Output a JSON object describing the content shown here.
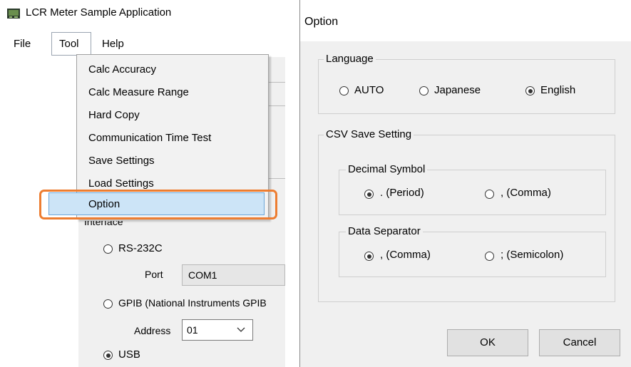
{
  "left": {
    "title": "LCR Meter Sample Application",
    "menu": {
      "file": "File",
      "tool": "Tool",
      "help": "Help"
    },
    "tool_menu": [
      "Calc Accuracy",
      "Calc Measure Range",
      "Hard Copy",
      "Communication Time Test",
      "Save Settings",
      "Load Settings"
    ],
    "option_item": "Option",
    "interface": {
      "label": "Interface",
      "rs232c": "RS-232C",
      "port_label": "Port",
      "port_value": "COM1",
      "gpib": "GPIB (National Instruments GPIB",
      "address_label": "Address",
      "address_value": "01",
      "usb": "USB"
    }
  },
  "dialog": {
    "title": "Option",
    "language": {
      "legend": "Language",
      "options": [
        "AUTO",
        "Japanese",
        "English"
      ],
      "selected": "English"
    },
    "csv": {
      "legend": "CSV Save Setting",
      "decimal": {
        "legend": "Decimal Symbol",
        "options": [
          ". (Period)",
          ", (Comma)"
        ],
        "selected": ". (Period)"
      },
      "separator": {
        "legend": "Data Separator",
        "options": [
          ", (Comma)",
          "; (Semicolon)"
        ],
        "selected": ", (Comma)"
      }
    },
    "buttons": {
      "ok": "OK",
      "cancel": "Cancel"
    }
  },
  "colors": {
    "highlight": "#cce4f7",
    "highlight_border": "#6ca7d9",
    "callout": "#ed7d31",
    "window_bg": "#f0f0f0"
  }
}
